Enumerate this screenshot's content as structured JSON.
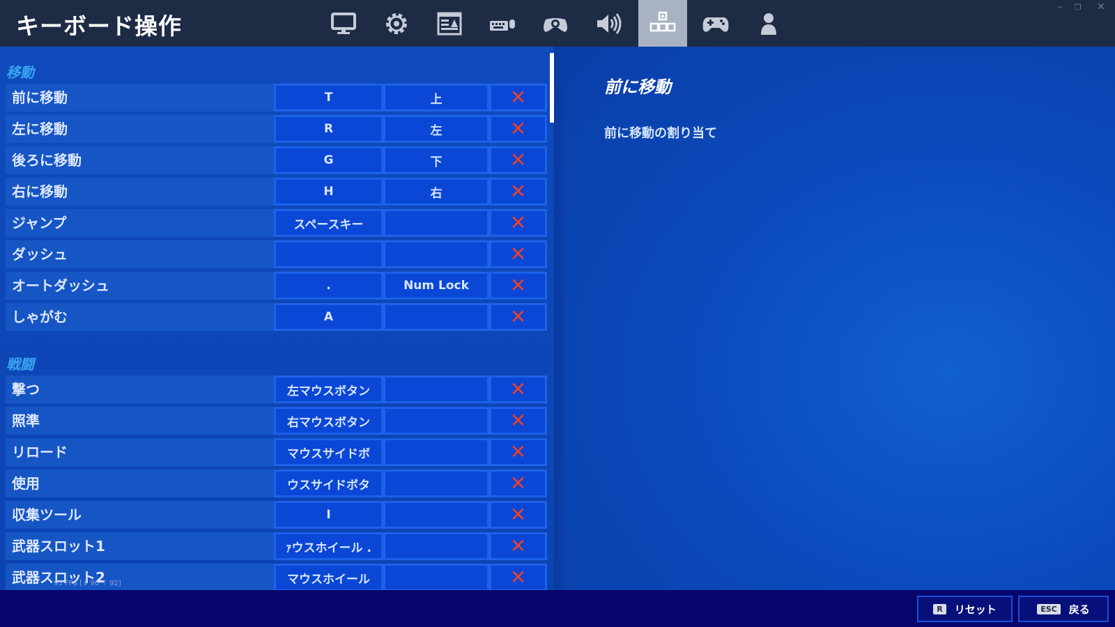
{
  "header": {
    "title": "キーボード操作",
    "tabs": [
      {
        "name": "monitor-icon"
      },
      {
        "name": "gear-icon"
      },
      {
        "name": "interface-icon"
      },
      {
        "name": "keyboard-mouse-icon"
      },
      {
        "name": "controller-settings-icon"
      },
      {
        "name": "speaker-icon"
      },
      {
        "name": "keybinds-icon",
        "active": true
      },
      {
        "name": "gamepad-icon"
      },
      {
        "name": "account-icon"
      }
    ]
  },
  "sections": [
    {
      "title": "移動",
      "rows": [
        {
          "label": "前に移動",
          "key1": "T",
          "key2": "上"
        },
        {
          "label": "左に移動",
          "key1": "R",
          "key2": "左"
        },
        {
          "label": "後ろに移動",
          "key1": "G",
          "key2": "下"
        },
        {
          "label": "右に移動",
          "key1": "H",
          "key2": "右"
        },
        {
          "label": "ジャンプ",
          "key1": "スペースキー",
          "key2": ""
        },
        {
          "label": "ダッシュ",
          "key1": "",
          "key2": ""
        },
        {
          "label": "オートダッシュ",
          "key1": ".",
          "key2": "Num Lock"
        },
        {
          "label": "しゃがむ",
          "key1": "A",
          "key2": ""
        }
      ]
    },
    {
      "title": "戦闘",
      "rows": [
        {
          "label": "撃つ",
          "key1": "左マウスボタン",
          "key2": ""
        },
        {
          "label": "照準",
          "key1": "右マウスボタン",
          "key2": ""
        },
        {
          "label": "リロード",
          "key1": "マウスサイドボ",
          "key2": ""
        },
        {
          "label": "使用",
          "key1": "ウスサイドボタ",
          "key2": ""
        },
        {
          "label": "収集ツール",
          "key1": "I",
          "key2": ""
        },
        {
          "label": "武器スロット1",
          "key1": "ｧウスホイール .",
          "key2": ""
        },
        {
          "label": "武器スロット2",
          "key1": "マウスホイール",
          "key2": ""
        }
      ]
    }
  ],
  "clear_symbol": "✕",
  "detail": {
    "title": "前に移動",
    "description": "前に移動の割り当て"
  },
  "fps": "93 FPS [↓ 90 ↑ 92]",
  "bottom": {
    "reset_key": "R",
    "reset_label": "リセット",
    "back_key": "ESC",
    "back_label": "戻る"
  },
  "colors": {
    "accent": "#3aa6f0",
    "clear": "#e8412f",
    "topbar": "#1e2b45"
  }
}
